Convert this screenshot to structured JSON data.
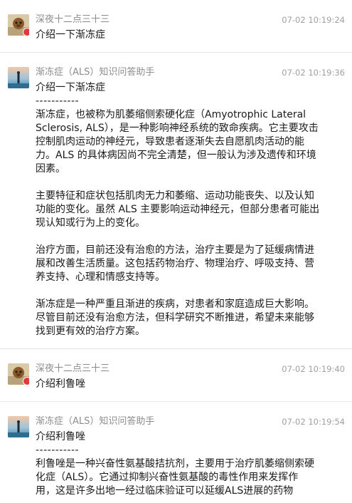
{
  "messages": [
    {
      "sender": "深夜十二点三十三",
      "time": "07-02 10:19:24",
      "lines": [
        "介绍一下渐冻症"
      ]
    },
    {
      "sender": "渐冻症（ALS）知识问答助手",
      "time": "07-02 10:19:36",
      "quote": "介绍一下渐冻症",
      "separator": "-----------",
      "paragraphs": [
        [
          "渐冻症，也被称为肌萎缩侧索硬化症（Amyotrophic Lateral",
          "Sclerosis, ALS），是一种影响神经系统的致命疾病。它主要攻击",
          "控制肌肉运动的神经元，导致患者逐渐失去自愿肌肉活动的能",
          "力。ALS 的具体病因尚不完全清楚，但一般认为涉及遗传和环境",
          "因素。"
        ],
        [
          "主要特征和症状包括肌肉无力和萎缩、运动功能丧失、以及认知",
          "功能的变化。虽然 ALS 主要影响运动神经元，但部分患者可能出",
          "现认知或行为上的变化。"
        ],
        [
          "治疗方面，目前还没有治愈的方法，治疗主要是为了延缓病情进",
          "展和改善生活质量。这包括药物治疗、物理治疗、呼吸支持、营",
          "养支持、心理和情感支持等。"
        ],
        [
          "渐冻症是一种严重且渐进的疾病，对患者和家庭造成巨大影响。",
          "尽管目前还没有治愈方法，但科学研究不断推进，希望未来能够",
          "找到更有效的治疗方案。"
        ]
      ]
    },
    {
      "sender": "深夜十二点三十三",
      "time": "07-02 10:19:40",
      "lines": [
        "介绍利鲁唑"
      ]
    },
    {
      "sender": "渐冻症（ALS）知识问答助手",
      "time": "07-02 10:19:54",
      "quote": "介绍利鲁唑",
      "separator": "-----------",
      "paragraphs": [
        [
          "利鲁唑是一种兴奋性氨基酸拮抗剂，主要用于治疗肌萎缩侧索硬",
          "化症（ALS）。它通过抑制兴奋性氨基酸的毒性作用来发挥作",
          "用，这是许多出地一经过临床验证可以延缓ALS进展的药物"
        ]
      ]
    }
  ]
}
